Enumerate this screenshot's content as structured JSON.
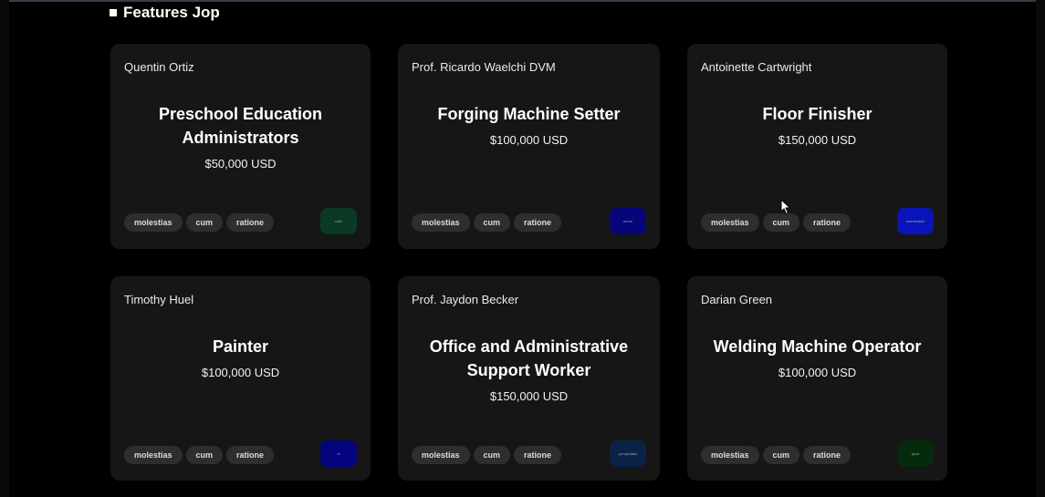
{
  "section": {
    "title": "Features Jop"
  },
  "cards": [
    {
      "author": "Quentin Ortiz",
      "title": "Preschool Education Administrators",
      "salary": "$50,000 USD",
      "tags": [
        "molestias",
        "cum",
        "ratione"
      ],
      "logo_color": "#0a3a24",
      "logo_text": "ratio"
    },
    {
      "author": "Prof. Ricardo Waelchi DVM",
      "title": "Forging Machine Setter",
      "salary": "$100,000 USD",
      "tags": [
        "molestias",
        "cum",
        "ratione"
      ],
      "logo_color": "#06067a",
      "logo_text": "rerum"
    },
    {
      "author": "Antoinette Cartwright",
      "title": "Floor Finisher",
      "salary": "$150,000 USD",
      "tags": [
        "molestias",
        "cum",
        "ratione"
      ],
      "logo_color": "#0a14b8",
      "logo_text": "exercitation"
    },
    {
      "author": "Timothy Huel",
      "title": "Painter",
      "salary": "$100,000 USD",
      "tags": [
        "molestias",
        "cum",
        "ratione"
      ],
      "logo_color": "#04047e",
      "logo_text": "et"
    },
    {
      "author": "Prof. Jaydon Becker",
      "title": "Office and Administrative Support Worker",
      "salary": "$150,000 USD",
      "tags": [
        "molestias",
        "cum",
        "ratione"
      ],
      "logo_color": "#0a2248",
      "logo_text": "perspiciatis"
    },
    {
      "author": "Darian Green",
      "title": "Welding Machine Operator",
      "salary": "$100,000 USD",
      "tags": [
        "molestias",
        "cum",
        "ratione"
      ],
      "logo_color": "#062a0c",
      "logo_text": "quos"
    }
  ]
}
